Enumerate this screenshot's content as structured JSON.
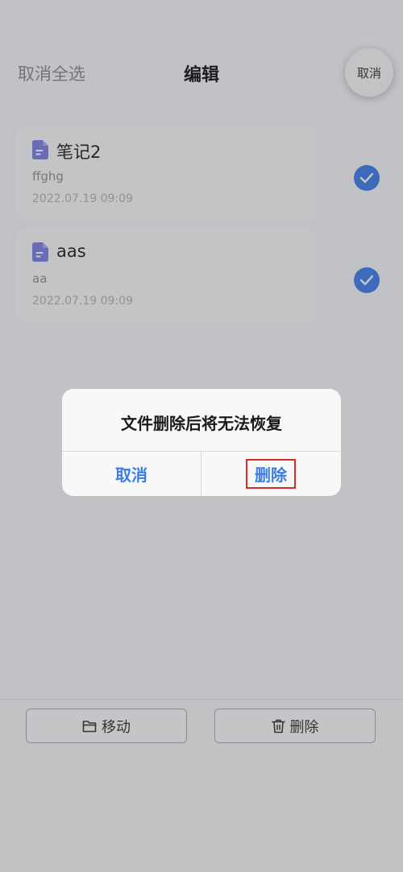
{
  "header": {
    "select_all_label": "取消全选",
    "title": "编辑",
    "cancel_label": "取消"
  },
  "notes": [
    {
      "title": "笔记2",
      "preview": "ffghg",
      "date": "2022.07.19 09:09",
      "selected": true
    },
    {
      "title": "aas",
      "preview": "aa",
      "date": "2022.07.19 09:09",
      "selected": true
    }
  ],
  "toolbar": {
    "move_label": "移动",
    "delete_label": "删除"
  },
  "dialog": {
    "message": "文件删除后将无法恢复",
    "cancel_label": "取消",
    "confirm_label": "删除"
  },
  "colors": {
    "accent": "#3d7ce8",
    "doc_icon": "#7b7fe3",
    "highlight_border": "#d62b2b"
  },
  "icons": {
    "note": "document-icon",
    "check": "check-icon",
    "move": "folder-icon",
    "delete": "trash-icon"
  }
}
